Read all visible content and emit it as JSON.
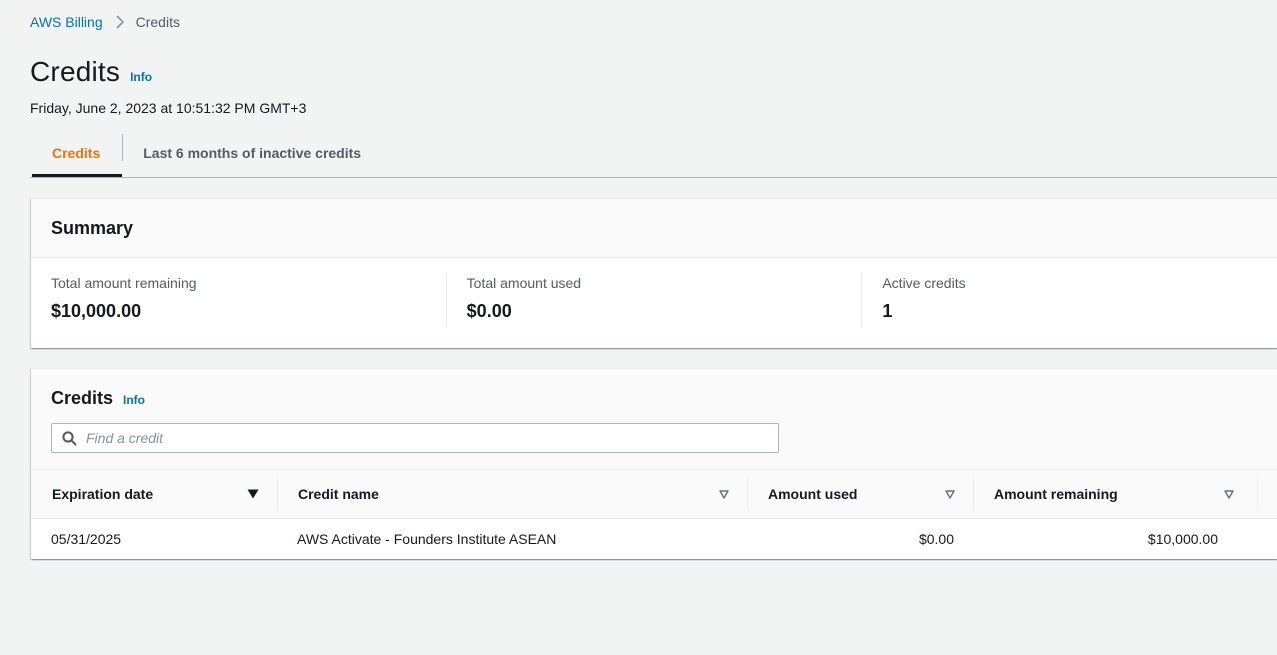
{
  "breadcrumb": {
    "root": "AWS Billing",
    "current": "Credits"
  },
  "header": {
    "title": "Credits",
    "info": "Info",
    "timestamp": "Friday, June 2, 2023 at 10:51:32 PM GMT+3"
  },
  "tabs": [
    {
      "label": "Credits",
      "active": true
    },
    {
      "label": "Last 6 months of inactive credits",
      "active": false
    }
  ],
  "summary": {
    "title": "Summary",
    "items": [
      {
        "label": "Total amount remaining",
        "value": "$10,000.00"
      },
      {
        "label": "Total amount used",
        "value": "$0.00"
      },
      {
        "label": "Active credits",
        "value": "1"
      }
    ]
  },
  "credits": {
    "title": "Credits",
    "info": "Info",
    "search_placeholder": "Find a credit",
    "columns": [
      "Expiration date",
      "Credit name",
      "Amount used",
      "Amount remaining"
    ],
    "rows": [
      {
        "expiration": "05/31/2025",
        "name": "AWS Activate - Founders Institute ASEAN",
        "used": "$0.00",
        "remaining": "$10,000.00"
      }
    ]
  },
  "icons": {
    "breadcrumb_separator": "chevron-right-icon",
    "search": "search-icon",
    "sort_active": "sort-descending-icon",
    "sort_inactive": "sort-icon"
  },
  "colors": {
    "link": "#0073bb",
    "active_tab": "#ec7211",
    "background": "#f2f3f3"
  }
}
